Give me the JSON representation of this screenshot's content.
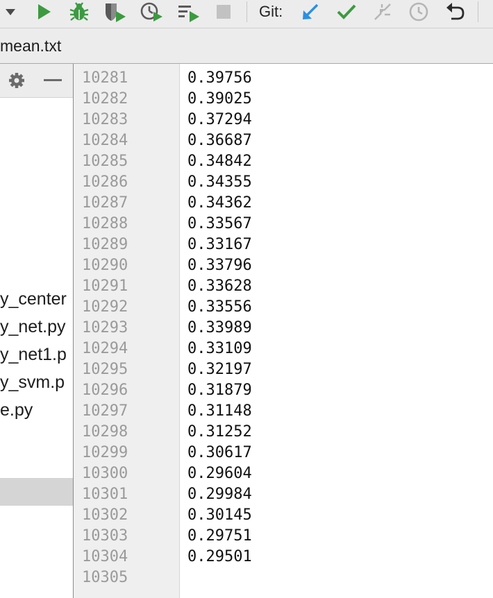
{
  "toolbar": {
    "git_label": "Git:",
    "buttons": [
      {
        "name": "dropdown-arrow-icon"
      },
      {
        "name": "run-icon",
        "color": "#3c9a41"
      },
      {
        "name": "debug-icon",
        "color": "#3c9a41"
      },
      {
        "name": "run-with-coverage-icon",
        "color": "#3c9a41"
      },
      {
        "name": "profile-icon",
        "color": "#3c9a41"
      },
      {
        "name": "concurrency-diagram-icon",
        "color": "#3c9a41"
      },
      {
        "name": "stop-icon",
        "color": "#c2c2c2"
      },
      {
        "name": "git-update-icon",
        "color": "#2d8fe0"
      },
      {
        "name": "git-commit-icon",
        "color": "#3c9a41"
      },
      {
        "name": "git-compare-icon",
        "color": "#b5b5b5"
      },
      {
        "name": "git-history-icon",
        "color": "#b5b5b5"
      },
      {
        "name": "git-rollback-icon",
        "color": "#2b2b2b"
      }
    ]
  },
  "tab": {
    "label": "mean.txt"
  },
  "project_panel": {
    "icons": [
      "gear-icon",
      "minimize-icon"
    ],
    "items": [
      "y_center",
      "y_net.py",
      "y_net1.p",
      "y_svm.p",
      "e.py"
    ]
  },
  "editor": {
    "lines": [
      {
        "num": "10281",
        "value": "0.39756"
      },
      {
        "num": "10282",
        "value": "0.39025"
      },
      {
        "num": "10283",
        "value": "0.37294"
      },
      {
        "num": "10284",
        "value": "0.36687"
      },
      {
        "num": "10285",
        "value": "0.34842"
      },
      {
        "num": "10286",
        "value": "0.34355"
      },
      {
        "num": "10287",
        "value": "0.34362"
      },
      {
        "num": "10288",
        "value": "0.33567"
      },
      {
        "num": "10289",
        "value": "0.33167"
      },
      {
        "num": "10290",
        "value": "0.33796"
      },
      {
        "num": "10291",
        "value": "0.33628"
      },
      {
        "num": "10292",
        "value": "0.33556"
      },
      {
        "num": "10293",
        "value": "0.33989"
      },
      {
        "num": "10294",
        "value": "0.33109"
      },
      {
        "num": "10295",
        "value": "0.32197"
      },
      {
        "num": "10296",
        "value": "0.31879"
      },
      {
        "num": "10297",
        "value": "0.31148"
      },
      {
        "num": "10298",
        "value": "0.31252"
      },
      {
        "num": "10299",
        "value": "0.30617"
      },
      {
        "num": "10300",
        "value": "0.29604"
      },
      {
        "num": "10301",
        "value": "0.29984"
      },
      {
        "num": "10302",
        "value": "0.30145"
      },
      {
        "num": "10303",
        "value": "0.29751"
      },
      {
        "num": "10304",
        "value": "0.29501"
      },
      {
        "num": "10305",
        "value": ""
      }
    ]
  }
}
